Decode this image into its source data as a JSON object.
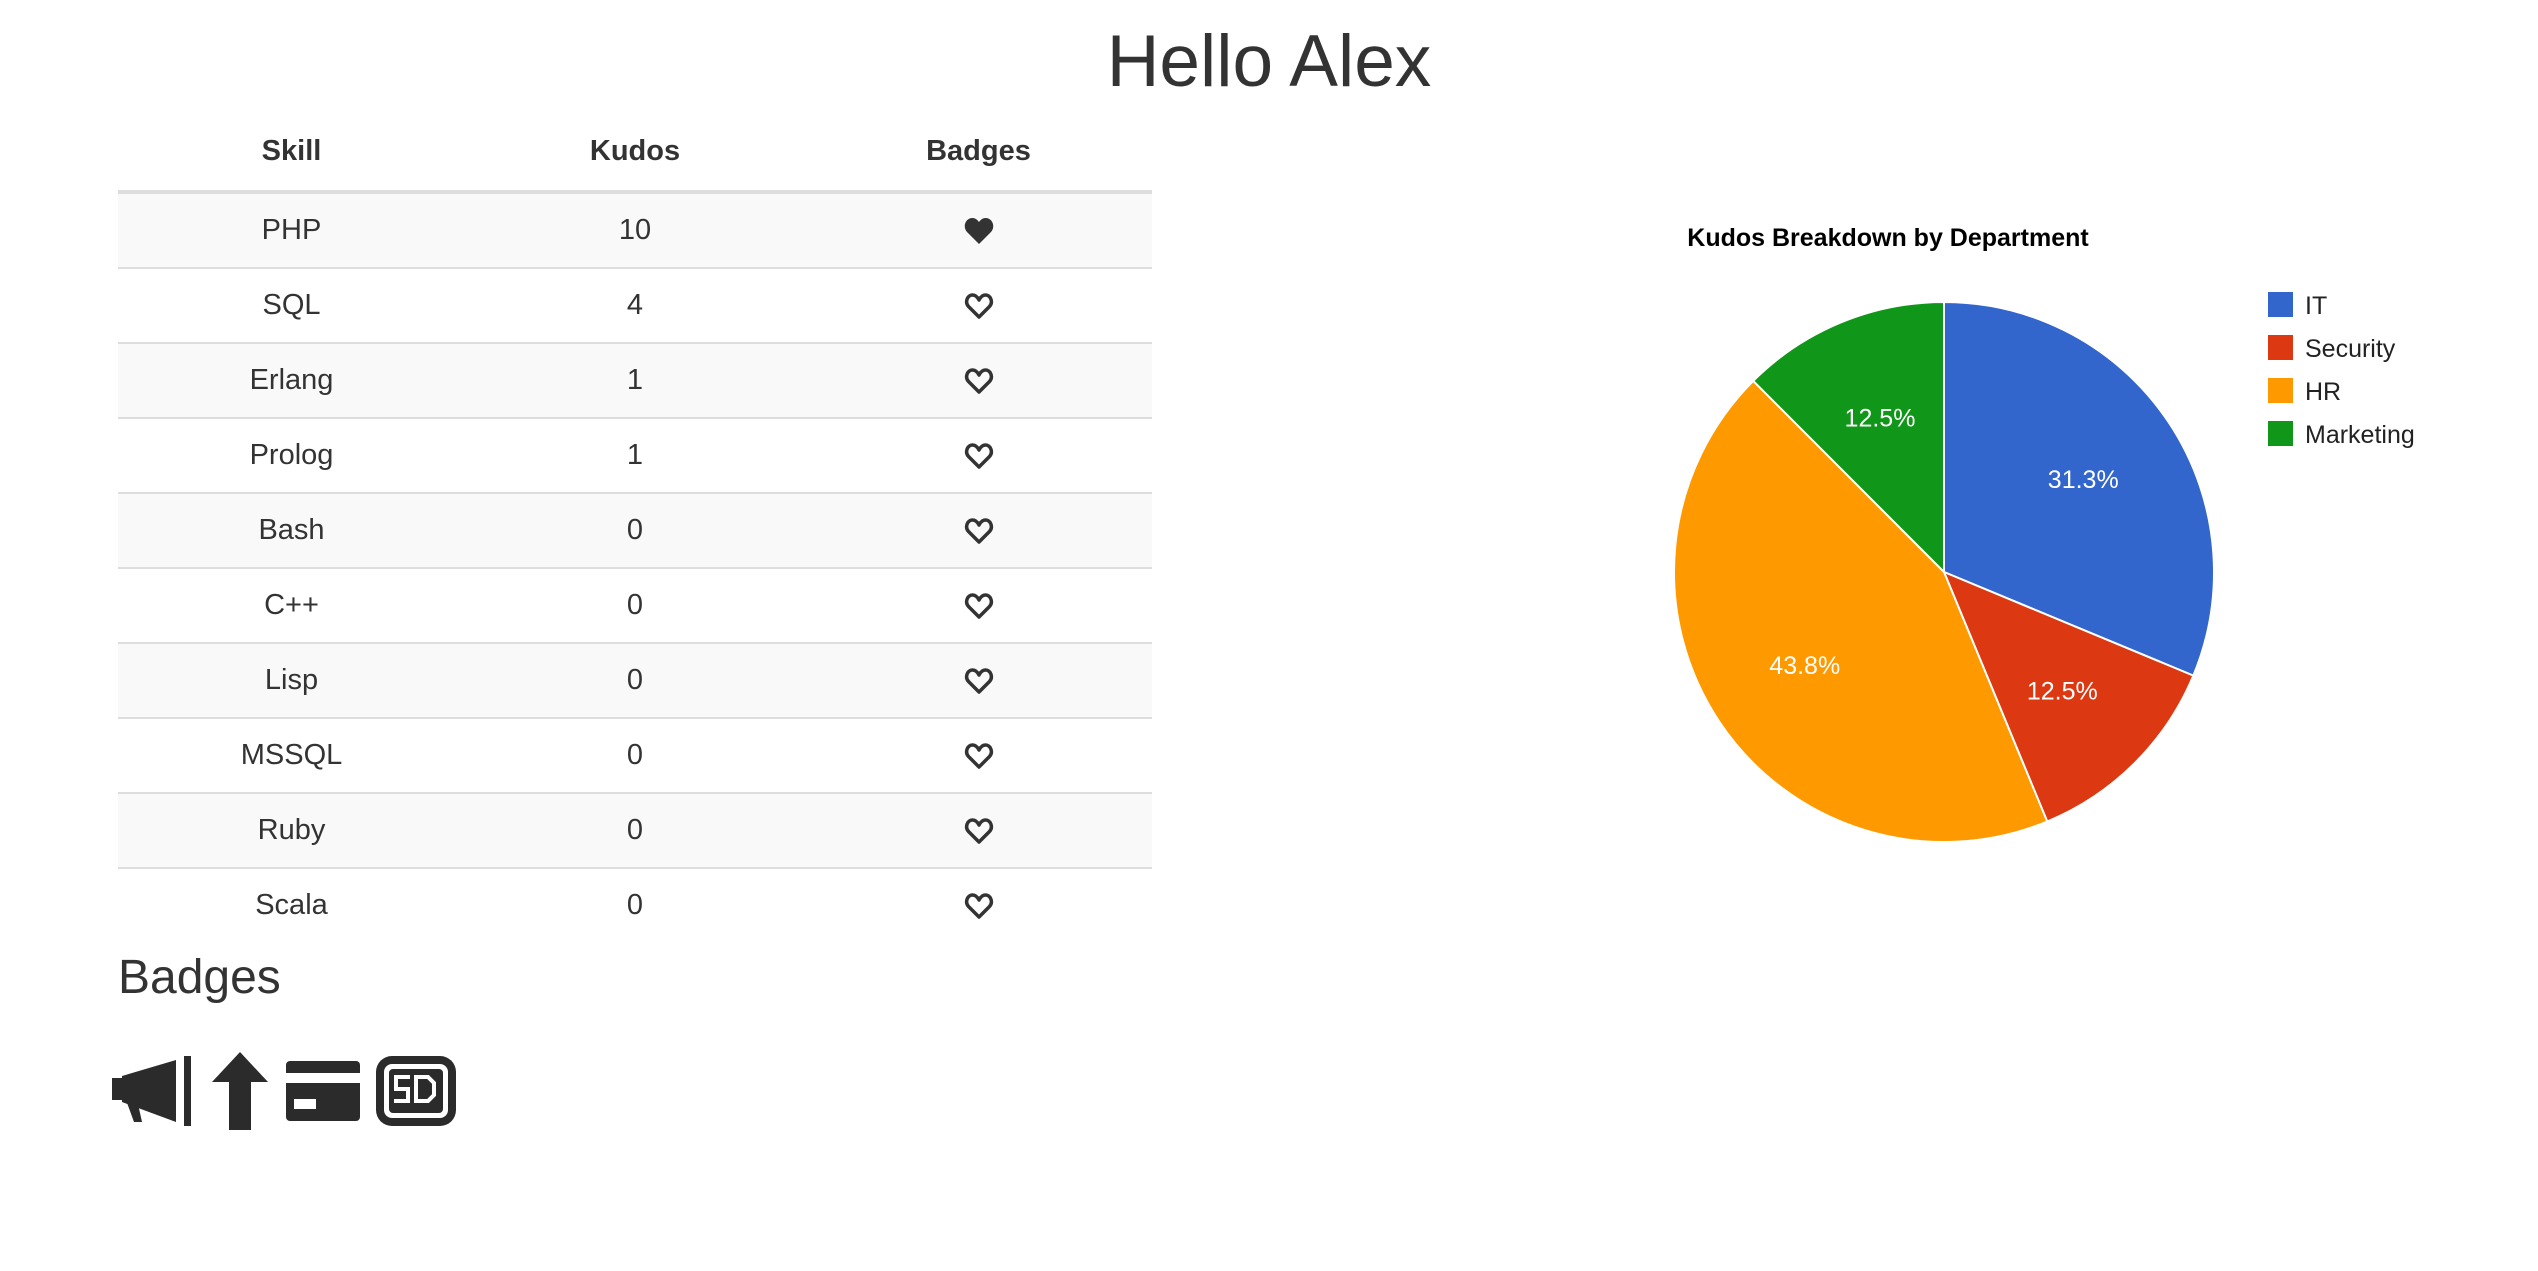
{
  "header": {
    "title": "Hello Alex"
  },
  "skills_table": {
    "columns": [
      "Skill",
      "Kudos",
      "Badges"
    ],
    "rows": [
      {
        "skill": "PHP",
        "kudos": "10",
        "badge": "heart-filled-icon"
      },
      {
        "skill": "SQL",
        "kudos": "4",
        "badge": "heart-outline-icon"
      },
      {
        "skill": "Erlang",
        "kudos": "1",
        "badge": "heart-outline-icon"
      },
      {
        "skill": "Prolog",
        "kudos": "1",
        "badge": "heart-outline-icon"
      },
      {
        "skill": "Bash",
        "kudos": "0",
        "badge": "heart-outline-icon"
      },
      {
        "skill": "C++",
        "kudos": "0",
        "badge": "heart-outline-icon"
      },
      {
        "skill": "Lisp",
        "kudos": "0",
        "badge": "heart-outline-icon"
      },
      {
        "skill": "MSSQL",
        "kudos": "0",
        "badge": "heart-outline-icon"
      },
      {
        "skill": "Ruby",
        "kudos": "0",
        "badge": "heart-outline-icon"
      },
      {
        "skill": "Scala",
        "kudos": "0",
        "badge": "heart-outline-icon"
      }
    ]
  },
  "badges_section": {
    "heading": "Badges",
    "icons": [
      "megaphone-icon",
      "arrow-up-icon",
      "credit-card-icon",
      "sd-icon"
    ]
  },
  "chart_data": {
    "type": "pie",
    "title": "Kudos Breakdown by Department",
    "categories": [
      "IT",
      "Security",
      "HR",
      "Marketing"
    ],
    "values": [
      31.3,
      12.5,
      43.8,
      12.5
    ],
    "labels": [
      "31.3%",
      "12.5%",
      "43.8%",
      "12.5%"
    ],
    "colors": [
      "#3366cc",
      "#dc3912",
      "#ff9900",
      "#109618"
    ],
    "legend": "right"
  }
}
